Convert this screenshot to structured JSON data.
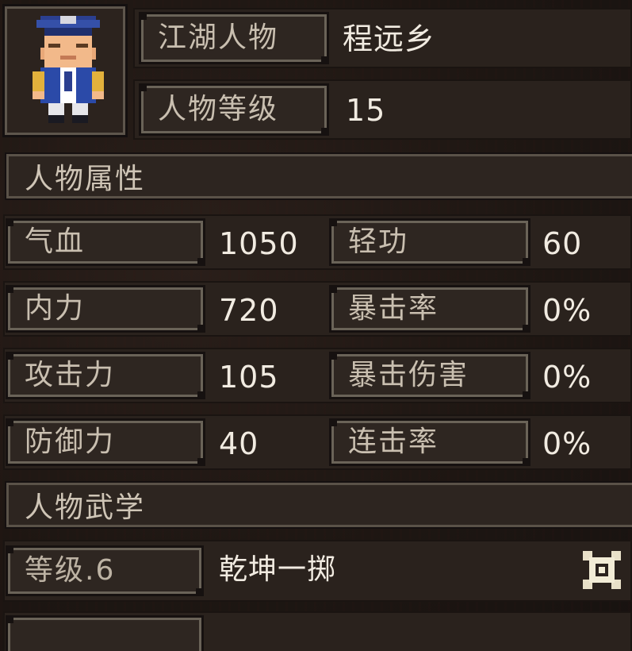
{
  "header": {
    "name_label": "江湖人物",
    "name_value": "程远乡",
    "level_label": "人物等级",
    "level_value": "15"
  },
  "attributes": {
    "section_title": "人物属性",
    "left": [
      {
        "label": "气血",
        "value": "1050"
      },
      {
        "label": "内力",
        "value": "720"
      },
      {
        "label": "攻击力",
        "value": "105"
      },
      {
        "label": "防御力",
        "value": "40"
      }
    ],
    "right": [
      {
        "label": "轻功",
        "value": "60"
      },
      {
        "label": "暴击率",
        "value": "0%"
      },
      {
        "label": "暴击伤害",
        "value": "0%"
      },
      {
        "label": "连击率",
        "value": "0%"
      }
    ]
  },
  "martial": {
    "section_title": "人物武学",
    "skills": [
      {
        "level_label": "等级.6",
        "name": "乾坤一掷",
        "icon": "shuriken-icon"
      }
    ]
  },
  "colors": {
    "background": "#1e1713",
    "label_text": "#c9bfb0",
    "value_text": "#f1ebe1",
    "frame": "#6a6358"
  }
}
